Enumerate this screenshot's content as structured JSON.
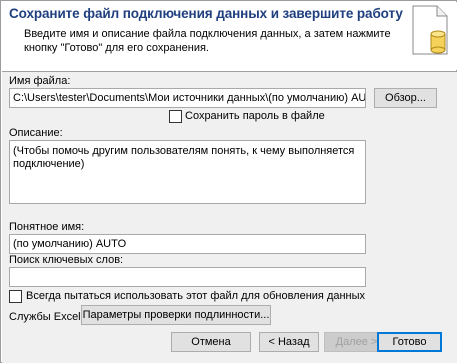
{
  "dialog": {
    "title": "Сохраните файл подключения данных и завершите работу",
    "subtitle": "Введите имя и описание файла подключения данных, а затем нажмите кнопку \"Готово\" для его сохранения."
  },
  "file_name": {
    "label": "Имя файла:",
    "value": "C:\\Users\\tester\\Documents\\Мои источники данных\\(по умолчанию) AUTO.odc",
    "browse_button": "Обзор..."
  },
  "save_password": {
    "label": "Сохранить пароль в файле",
    "checked": false
  },
  "description": {
    "label": "Описание:",
    "value": "(Чтобы помочь другим пользователям понять, к чему выполняется подключение)"
  },
  "friendly_name": {
    "label": "Понятное имя:",
    "value": "(по умолчанию) AUTO"
  },
  "search_keywords": {
    "label": "Поиск ключевых слов:",
    "value": ""
  },
  "always_use": {
    "label": "Всегда пытаться использовать этот файл для обновления данных",
    "checked": false
  },
  "excel_services": {
    "label": "Службы Excel:",
    "button": "Параметры проверки подлинности..."
  },
  "footer": {
    "cancel": "Отмена",
    "back": "< Назад",
    "next": "Далее >",
    "finish": "Готово"
  }
}
